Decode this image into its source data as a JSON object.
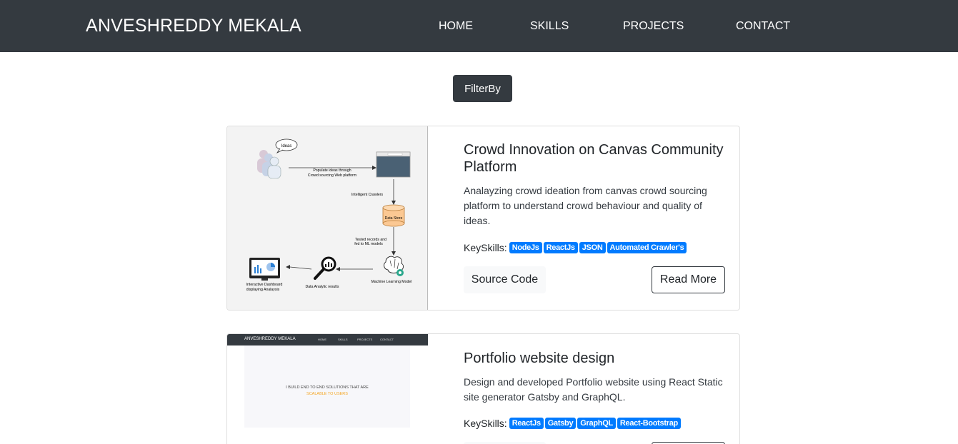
{
  "navbar": {
    "brand": "ANVESHREDDY MEKALA",
    "links": [
      "HOME",
      "SKILLS",
      "PROJECTS",
      "CONTACT"
    ]
  },
  "filter": {
    "label": "FilterBy"
  },
  "projects": [
    {
      "title": "Crowd Innovation on Canvas Community Platform",
      "description": "Analayzing crowd ideation from canvas crowd sourcing platform to understand crowd behaviour and quality of ideas.",
      "skills_label": "KeySkills:",
      "skills": [
        "NodeJs",
        "ReactJs",
        "JSON",
        "Automated Crawler's"
      ],
      "source_label": "Source Code",
      "read_label": "Read More",
      "diagram": {
        "ideas": "Ideas",
        "populate_line1": "Populate ideas through",
        "populate_line2": "Crowd sourcing Web platform",
        "crawlers": "Intelligent Crawlers",
        "datastore": "Data Store",
        "tested_line1": "Tested records and",
        "tested_line2": "fed to ML models",
        "ml_model": "Machine Learning Model",
        "analytic": "Data Analytic results",
        "dashboard_line1": "Interactive Dashboard",
        "dashboard_line2": "displaying Analaysis"
      }
    },
    {
      "title": "Portfolio website design",
      "description": "Design and developed Portfolio website using React Static site generator Gatsby and GraphQL.",
      "skills_label": "KeySkills:",
      "skills": [
        "ReactJs",
        "Gatsby",
        "GraphQL",
        "React-Bootstrap"
      ],
      "thumb": {
        "brand": "ANVESHREDDY MEKALA",
        "links": [
          "HOME",
          "SKILLS",
          "PROJECTS",
          "CONTACT"
        ],
        "hero_line1": "I BUILD END TO END SOLUTIONS THAT ARE",
        "hero_line2": "SCALABLE TO USERS"
      }
    }
  ],
  "colors": {
    "navbar": "#343a40",
    "badge": "#007bff",
    "accent_orange": "#f5a623"
  }
}
